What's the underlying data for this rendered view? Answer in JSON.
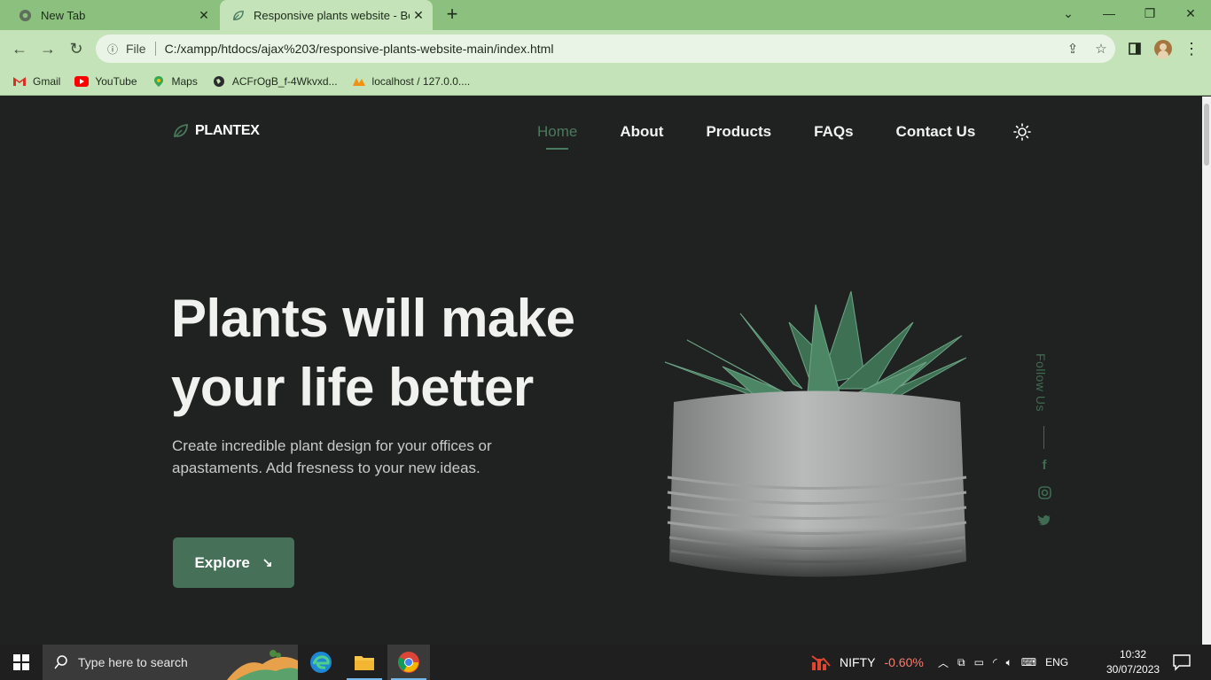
{
  "browser": {
    "tabs": [
      {
        "label": "New Tab",
        "active": false
      },
      {
        "label": "Responsive plants website - Bedi",
        "active": true
      }
    ],
    "address": {
      "scheme_label": "File",
      "url": "C:/xampp/htdocs/ajax%203/responsive-plants-website-main/index.html"
    },
    "bookmarks": [
      {
        "label": "Gmail",
        "icon": "gmail-icon"
      },
      {
        "label": "YouTube",
        "icon": "youtube-icon"
      },
      {
        "label": "Maps",
        "icon": "maps-icon"
      },
      {
        "label": "ACFrOgB_f-4Wkvxd...",
        "icon": "globe-icon"
      },
      {
        "label": "localhost / 127.0.0....",
        "icon": "phpmyadmin-icon"
      }
    ]
  },
  "site": {
    "logo": "PLANTEX",
    "nav": [
      "Home",
      "About",
      "Products",
      "FAQs",
      "Contact Us"
    ],
    "active_nav": "Home",
    "hero": {
      "title_line1": "Plants will make",
      "title_line2": "your life better",
      "description": "Create incredible plant design for your offices or apastaments. Add fresness to your new ideas.",
      "button": "Explore",
      "button_arrow": "↘"
    },
    "follow_label": "Follow Us",
    "social": [
      "facebook-icon",
      "instagram-icon",
      "twitter-icon"
    ],
    "accent_color": "#467158",
    "background_color": "#1f2220"
  },
  "taskbar": {
    "search_placeholder": "Type here to search",
    "apps": [
      "edge-icon",
      "file-explorer-icon",
      "chrome-icon"
    ],
    "ticker_name": "NIFTY",
    "ticker_change": "-0.60%",
    "language": "ENG",
    "time": "10:32",
    "date": "30/07/2023"
  }
}
